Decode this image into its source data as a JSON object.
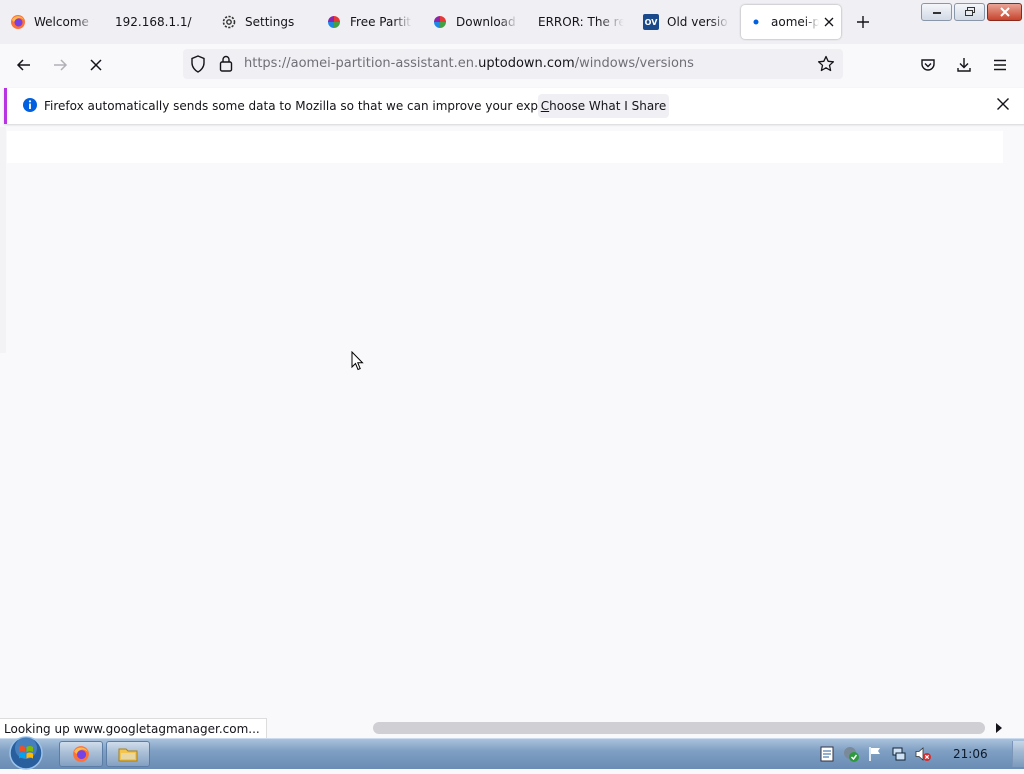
{
  "tabs": [
    {
      "title": "Welcome to",
      "icon": "firefox-icon"
    },
    {
      "title": "192.168.1.1/",
      "icon": ""
    },
    {
      "title": "Settings",
      "icon": "gear-icon"
    },
    {
      "title": "Free Partitio",
      "icon": "aomei-icon"
    },
    {
      "title": "Download F",
      "icon": "aomei-icon"
    },
    {
      "title": "ERROR: The req",
      "icon": ""
    },
    {
      "title": "Old version",
      "icon": "ov-icon"
    },
    {
      "title": "aomei-pa",
      "icon": "dot-icon",
      "active": true
    }
  ],
  "ov_badge": "OV",
  "address": {
    "prefix": "https://aomei-partition-assistant.en.",
    "domain": "uptodown.com",
    "path": "/windows/versions"
  },
  "notification": {
    "message": "Firefox automatically sends some data to Mozilla so that we can improve your experience.",
    "button_first": "C",
    "button_rest": "hoose What I Share"
  },
  "status": {
    "text": "Looking up www.googletagmanager.com..."
  },
  "taskbar": {
    "clock": "21:06"
  },
  "colors": {
    "accent": "#b833e1",
    "info_blue": "#0060df",
    "ov_blue": "#1a4a8a"
  }
}
